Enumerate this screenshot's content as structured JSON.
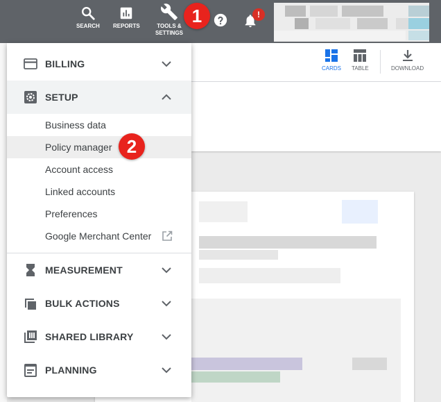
{
  "topbar": {
    "search_label": "SEARCH",
    "reports_label": "REPORTS",
    "tools_label": "TOOLS &\nSETTINGS",
    "help_icon": "help-icon",
    "notifications_badge": "!"
  },
  "annotations": {
    "step_one": "1",
    "step_two": "2"
  },
  "toolbar": {
    "cards_label": "CARDS",
    "table_label": "TABLE",
    "download_label": "DOWNLOAD"
  },
  "menu": {
    "billing": "BILLING",
    "setup": "SETUP",
    "setup_items": [
      "Business data",
      "Policy manager",
      "Account access",
      "Linked accounts",
      "Preferences",
      "Google Merchant Center"
    ],
    "measurement": "MEASUREMENT",
    "bulk_actions": "BULK ACTIONS",
    "shared_library": "SHARED LIBRARY",
    "planning": "PLANNING"
  },
  "colors": {
    "topbar": "#5f6368",
    "accent": "#1a73e8",
    "callout": "#e8231d",
    "alert": "#d93025"
  }
}
